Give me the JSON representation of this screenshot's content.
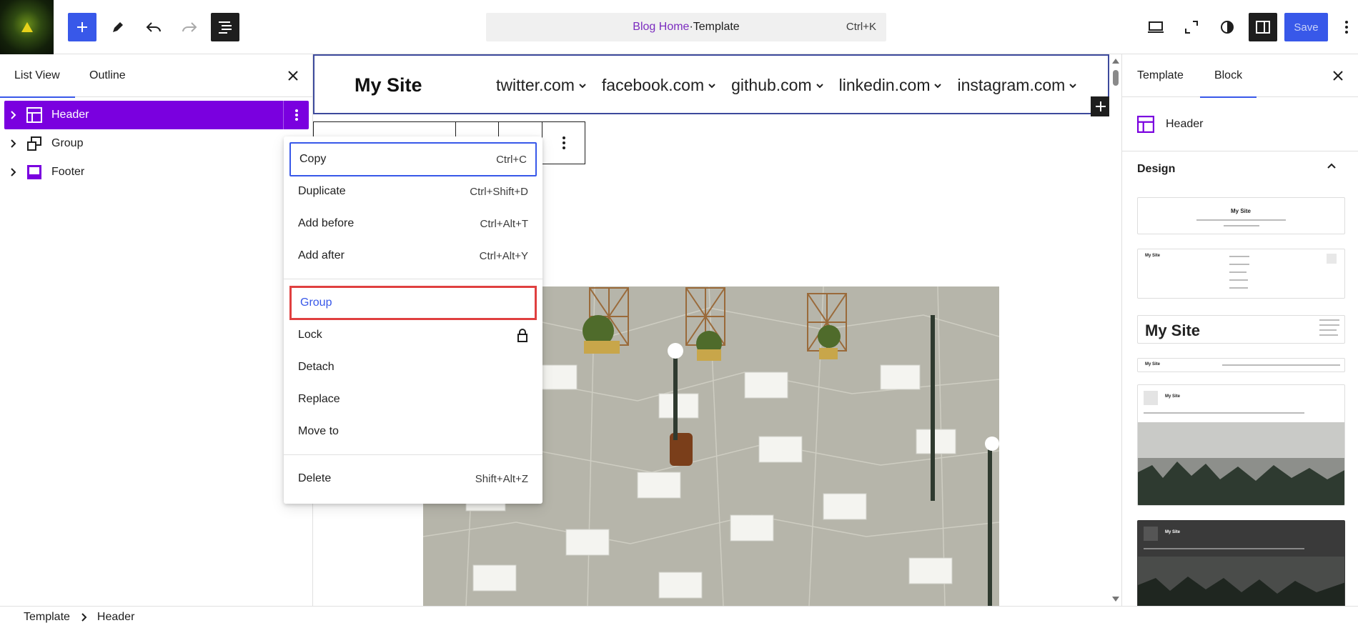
{
  "toolbar": {
    "command_bar": {
      "page": "Blog Home",
      "separator": " · ",
      "type": "Template",
      "shortcut": "Ctrl+K"
    },
    "save_label": "Save",
    "accent": "#3858e9"
  },
  "left_panel": {
    "tabs": [
      {
        "label": "List View",
        "active": true
      },
      {
        "label": "Outline",
        "active": false
      }
    ],
    "items": [
      {
        "label": "Header",
        "icon": "header-block-icon",
        "selected": true
      },
      {
        "label": "Group",
        "icon": "group-block-icon",
        "selected": false
      },
      {
        "label": "Footer",
        "icon": "footer-block-icon",
        "selected": false
      }
    ],
    "selected_color": "#7a00df"
  },
  "canvas": {
    "site_title": "My Site",
    "nav": [
      "twitter.com",
      "facebook.com",
      "github.com",
      "linkedin.com",
      "instagram.com"
    ]
  },
  "context_menu": {
    "groups": [
      [
        {
          "label": "Copy",
          "shortcut": "Ctrl+C",
          "state": "focused"
        },
        {
          "label": "Duplicate",
          "shortcut": "Ctrl+Shift+D"
        },
        {
          "label": "Add before",
          "shortcut": "Ctrl+Alt+T"
        },
        {
          "label": "Add after",
          "shortcut": "Ctrl+Alt+Y"
        }
      ],
      [
        {
          "label": "Group",
          "shortcut": "",
          "state": "highlighted"
        },
        {
          "label": "Lock",
          "shortcut": "",
          "icon": "lock-icon"
        },
        {
          "label": "Detach",
          "shortcut": ""
        },
        {
          "label": "Replace",
          "shortcut": ""
        },
        {
          "label": "Move to",
          "shortcut": ""
        }
      ],
      [
        {
          "label": "Delete",
          "shortcut": "Shift+Alt+Z"
        }
      ]
    ]
  },
  "right_panel": {
    "tabs": [
      {
        "label": "Template",
        "active": false
      },
      {
        "label": "Block",
        "active": true
      }
    ],
    "block_name": "Header",
    "section_title": "Design",
    "patterns": [
      {
        "title": "My Site",
        "nav": "twitter.com · facebook.com · github.com · linkedin.com · instagram.com"
      },
      {
        "title": "My Site",
        "nav": "twitter.com · facebook.com · github.com · linkedin.com · instagram.com"
      },
      {
        "title": "My Site",
        "nav": "twitter.com · facebook.com · github.com · linkedin.com · instagram.com"
      },
      {
        "title": "My Site",
        "nav": "twitter.com · facebook.com · github.com · linkedin.com · instagram.com"
      },
      {
        "title": "My Site",
        "nav": "twitter.com · facebook.com · github.com · linkedin.com · instagram.com"
      },
      {
        "title": "My Site",
        "nav": "twitter.com · facebook.com · github.com · linkedin.com · instagram.com"
      }
    ]
  },
  "status_bar": {
    "breadcrumbs": [
      "Template",
      "Header"
    ]
  }
}
